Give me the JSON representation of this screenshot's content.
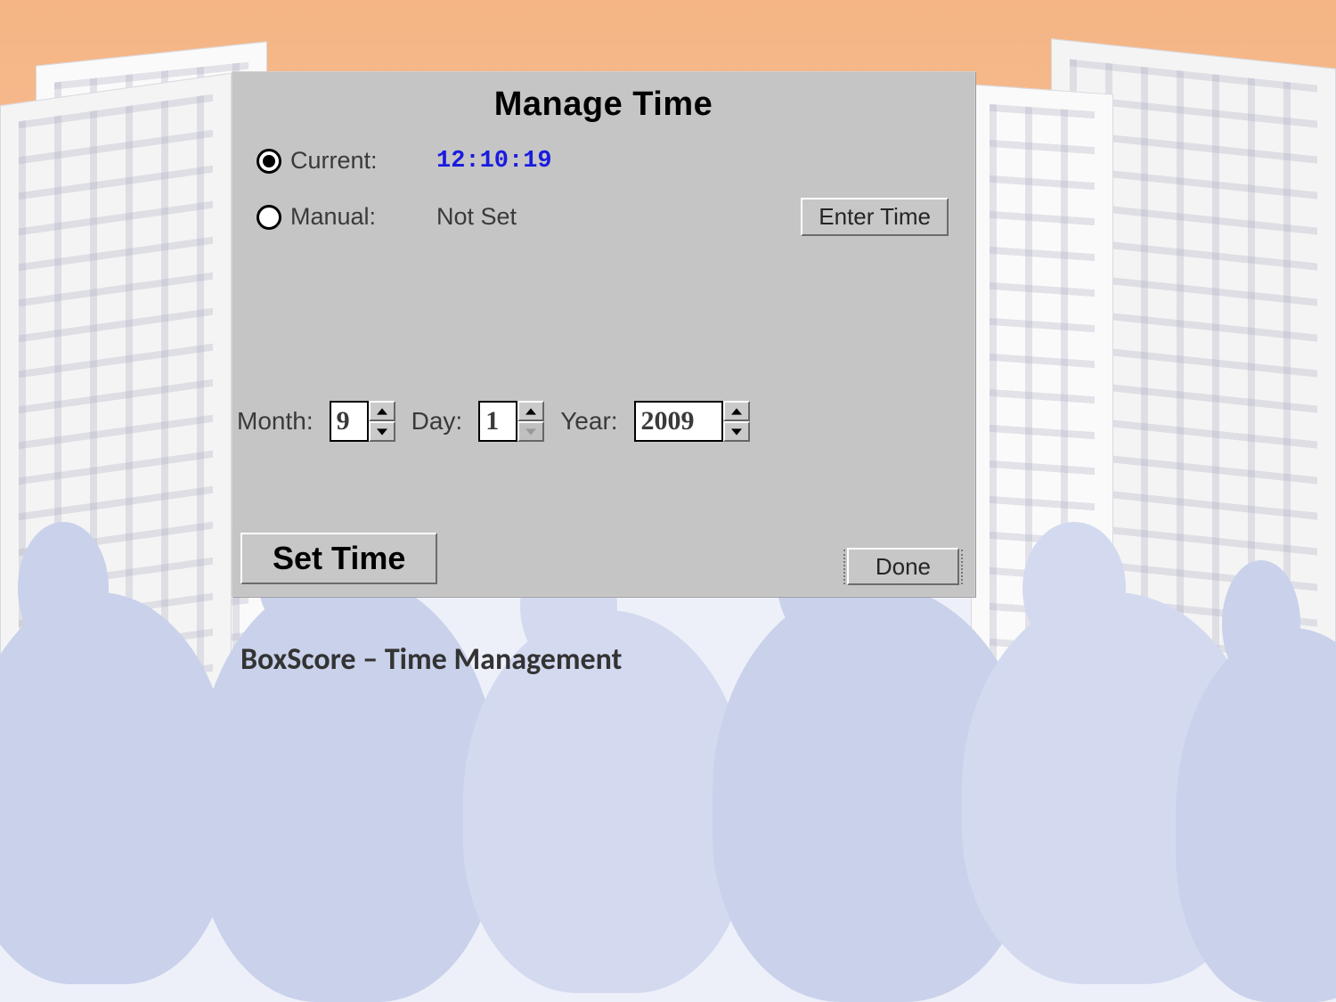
{
  "dialog": {
    "title": "Manage Time",
    "current": {
      "label": "Current:",
      "value": "12:10:19",
      "selected": true
    },
    "manual": {
      "label": "Manual:",
      "value": "Not Set",
      "selected": false
    },
    "enter_time_label": "Enter Time",
    "date": {
      "month_label": "Month:",
      "month_value": "9",
      "day_label": "Day:",
      "day_value": "1",
      "year_label": "Year:",
      "year_value": "2009"
    },
    "set_time_label": "Set Time",
    "done_label": "Done"
  },
  "caption": "BoxScore – Time Management"
}
